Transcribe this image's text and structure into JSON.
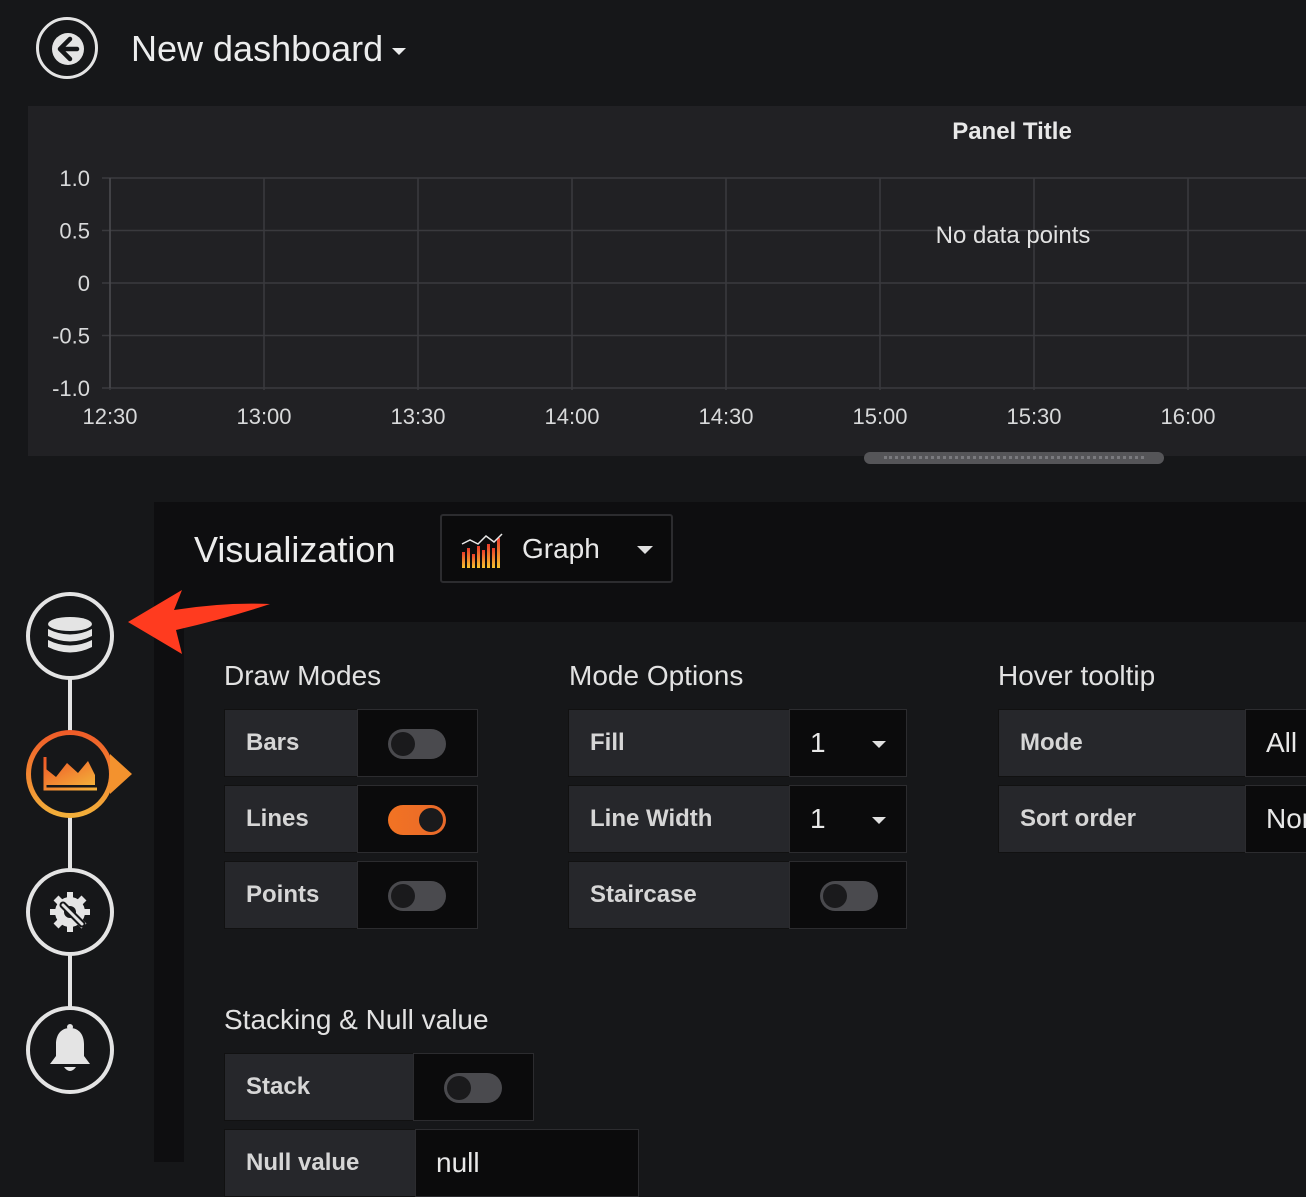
{
  "header": {
    "title": "New dashboard"
  },
  "panel": {
    "title": "Panel Title",
    "no_data": "No data points"
  },
  "chart_data": {
    "type": "line",
    "title": "Panel Title",
    "x_ticks": [
      "12:30",
      "13:00",
      "13:30",
      "14:00",
      "14:30",
      "15:00",
      "15:30",
      "16:00"
    ],
    "y_ticks": [
      "1.0",
      "0.5",
      "0",
      "-0.5",
      "-1.0"
    ],
    "ylim": [
      -1.0,
      1.0
    ],
    "series": [],
    "grid": true,
    "annotation": "No data points"
  },
  "editor": {
    "viz_label": "Visualization",
    "viz_selected": "Graph",
    "draw_modes": {
      "title": "Draw Modes",
      "rows": [
        {
          "label": "Bars",
          "on": false
        },
        {
          "label": "Lines",
          "on": true
        },
        {
          "label": "Points",
          "on": false
        }
      ]
    },
    "mode_options": {
      "title": "Mode Options",
      "fill_label": "Fill",
      "fill_value": "1",
      "linewidth_label": "Line Width",
      "linewidth_value": "1",
      "staircase_label": "Staircase",
      "staircase_on": false
    },
    "hover_tooltip": {
      "title": "Hover tooltip",
      "mode_label": "Mode",
      "mode_value": "All",
      "sort_label": "Sort order",
      "sort_value": "Nor"
    },
    "stacking": {
      "title": "Stacking & Null value",
      "stack_label": "Stack",
      "stack_on": false,
      "null_label": "Null value",
      "null_value": "null"
    }
  },
  "steps": [
    "queries-icon",
    "visualization-icon",
    "general-settings-icon",
    "alert-icon"
  ],
  "colors": {
    "accent": "#f27323",
    "arrow": "#ff3b1f",
    "background": "#161719",
    "panel": "#212124"
  }
}
